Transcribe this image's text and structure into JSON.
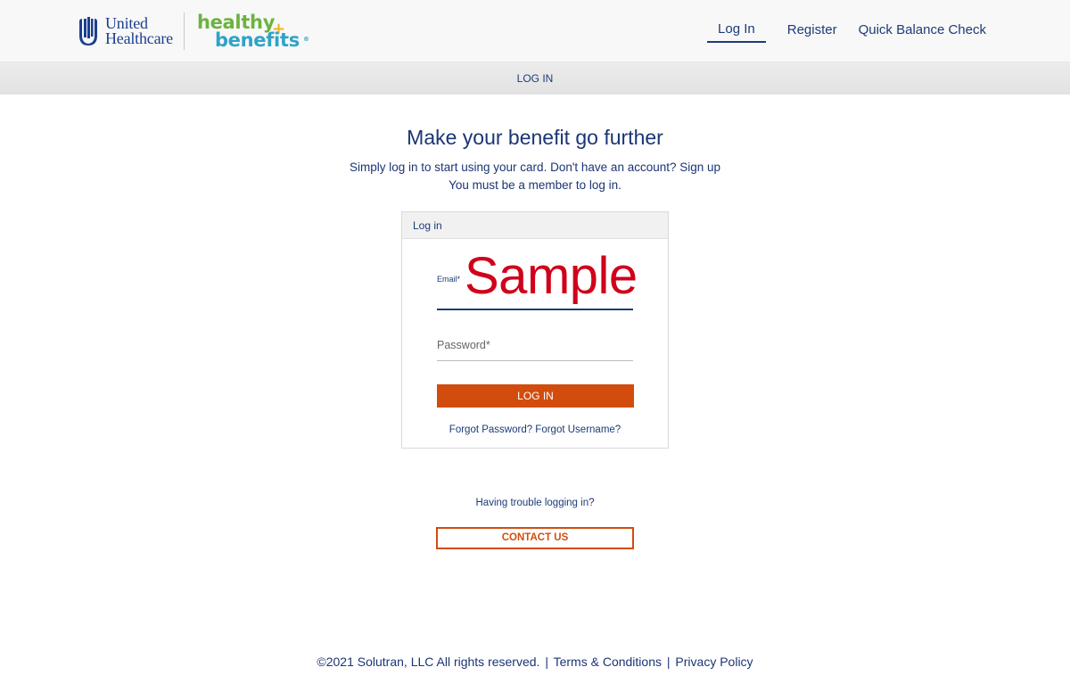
{
  "header": {
    "brand_primary_line1": "United",
    "brand_primary_line2": "Healthcare",
    "brand_secondary_top": "healthy",
    "brand_secondary_plus": "+",
    "brand_secondary_bottom": "benefits",
    "brand_secondary_reg": "®",
    "nav": [
      {
        "label": "Log In",
        "active": true
      },
      {
        "label": "Register",
        "active": false
      },
      {
        "label": "Quick Balance Check",
        "active": false
      }
    ]
  },
  "subbar": {
    "label": "LOG IN"
  },
  "main": {
    "title": "Make your benefit go further",
    "subtitle_line1": "Simply log in to start using your card. Don't have an account? Sign up",
    "subtitle_line2": "You must be a member to log in."
  },
  "login_card": {
    "heading": "Log in",
    "email_label": "Email*",
    "email_value": "Sample",
    "password_label": "Password*",
    "submit_label": "LOG IN",
    "forgot_text": "Forgot Password? Forgot Username?"
  },
  "help": {
    "trouble_text": "Having trouble logging in?",
    "contact_label": "CONTACT US"
  },
  "footer": {
    "copyright": "©2021 Solutran, LLC All rights reserved.",
    "separator": "|",
    "terms": "Terms & Conditions",
    "privacy": "Privacy Policy"
  },
  "colors": {
    "primary_navy": "#1d3b78",
    "accent_orange": "#d24c0d",
    "sample_red": "#d0021b",
    "healthy_green": "#6cb33f",
    "benefits_blue": "#2ea3c9",
    "plus_yellow": "#f2b41c"
  }
}
